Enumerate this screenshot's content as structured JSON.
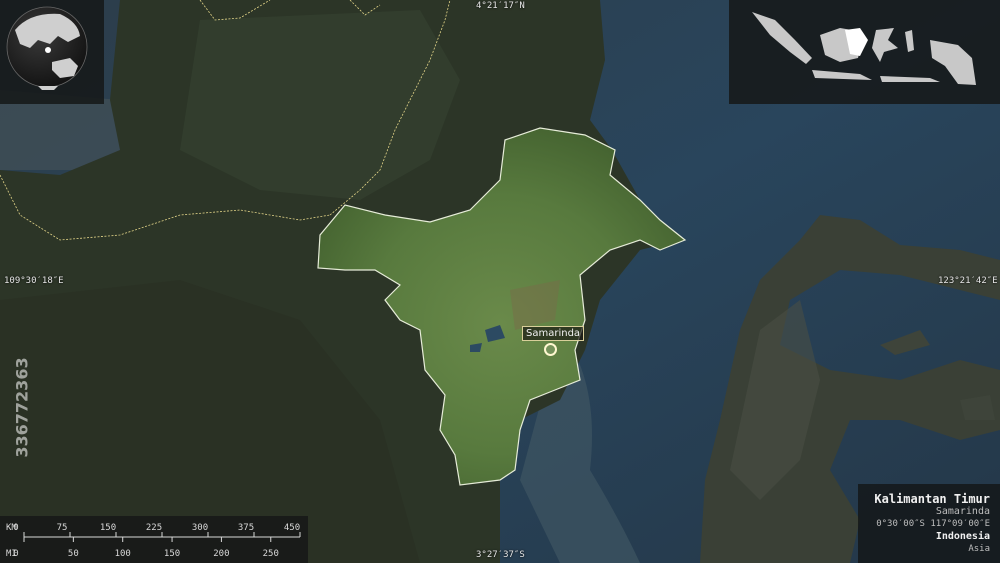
{
  "map": {
    "coordinates": {
      "top": "4°21′17″N",
      "bottom": "3°27′37″S",
      "left": "109°30′18″E",
      "right": "123°21′42″E"
    },
    "city_label": "Samarinda",
    "info": {
      "region": "Kalimantan Timur",
      "capital": "Samarinda",
      "coords": "0°30′00″S 117°09′00″E",
      "country": "Indonesia",
      "continent": "Asia"
    },
    "scale": {
      "km_unit": "KM",
      "mi_unit": "MI",
      "km_ticks": [
        "0",
        "75",
        "150",
        "225",
        "300",
        "375",
        "450"
      ],
      "mi_ticks": [
        "0",
        "50",
        "100",
        "150",
        "200",
        "250"
      ]
    },
    "watermark_id": "336772363",
    "colors": {
      "ocean": "#2a3d4d",
      "land": "#2f3a2a",
      "highlight": "#5f7a44",
      "border": "#e8d98a"
    }
  }
}
